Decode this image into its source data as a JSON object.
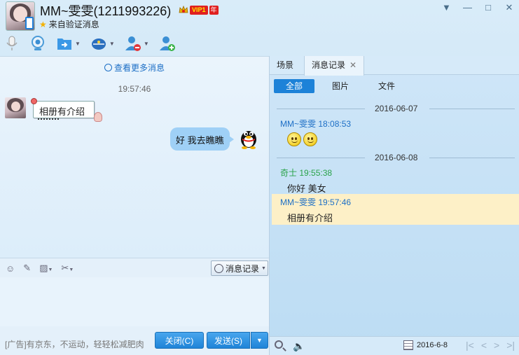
{
  "header": {
    "title": "MM~雯雯(1211993226)",
    "vip_label": "VIP1",
    "vip_year": "年",
    "subtitle": "来自验证消息",
    "window_controls": [
      "▼",
      "—",
      "□",
      "✕"
    ]
  },
  "toolbar": {
    "items": [
      "microphone-icon",
      "video-icon",
      "file-transfer-icon",
      "app-icon",
      "remove-contact-icon",
      "add-contact-icon"
    ]
  },
  "chat": {
    "more_messages": "查看更多消息",
    "timestamp": "19:57:46",
    "incoming_message": "相册有介绍",
    "outgoing_message": "好 我去瞧瞧"
  },
  "input_toolbar": {
    "history_button": "消息记录"
  },
  "footer": {
    "ad_text": "[广告]有京东，不运动，轻轻松减肥肉",
    "close_button": "关闭(C)",
    "send_button": "发送(S)"
  },
  "history": {
    "tabs": [
      {
        "label": "场景"
      },
      {
        "label": "消息记录"
      }
    ],
    "filters": [
      {
        "label": "全部",
        "active": true
      },
      {
        "label": "图片",
        "active": false
      },
      {
        "label": "文件",
        "active": false
      }
    ],
    "groups": [
      {
        "date": "2016-06-07",
        "records": [
          {
            "sender": "MM~雯雯",
            "time": "18:08:53",
            "text": "",
            "emoji_count": 2,
            "color": "#1d6fc6"
          }
        ]
      },
      {
        "date": "2016-06-08",
        "records": [
          {
            "sender": "奇士",
            "time": "19:55:38",
            "text": "你好 美女",
            "color": "#2aa34a"
          },
          {
            "sender": "MM~雯雯",
            "time": "19:57:46",
            "text": "相册有介绍",
            "color": "#1d6fc6",
            "highlighted": true
          }
        ]
      }
    ],
    "bottom_date": "2016-6-8"
  },
  "colors": {
    "accent": "#1d82d8",
    "self_name": "#2aa34a",
    "other_name": "#1d6fc6",
    "highlight": "#fdf0c7"
  }
}
